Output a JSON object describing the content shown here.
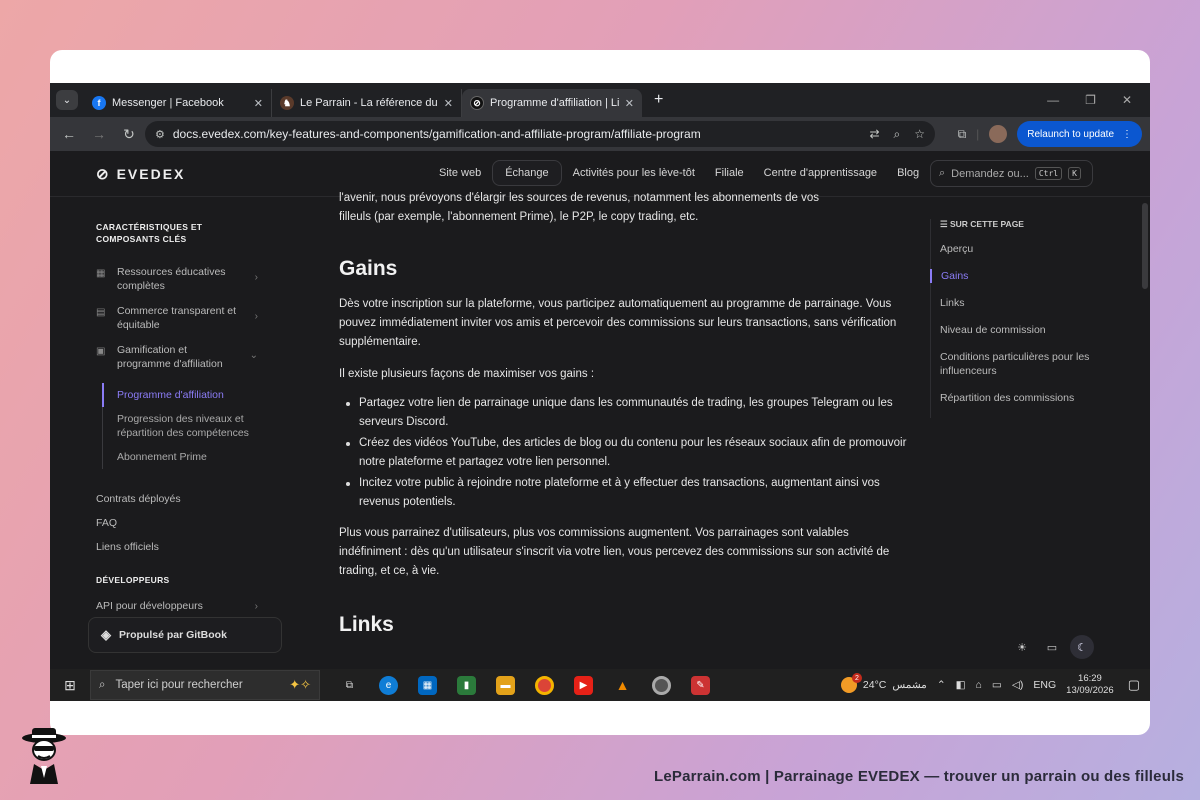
{
  "browser": {
    "tabs": [
      {
        "title": "Messenger | Facebook",
        "favicon": "facebook-icon"
      },
      {
        "title": "Le Parrain - La référence du parrainage",
        "favicon": "leparrain-icon"
      },
      {
        "title": "Programme d'affiliation | Livre blanc",
        "favicon": "evedex-icon"
      }
    ],
    "url": "docs.evedex.com/key-features-and-components/gamification-and-affiliate-program/affiliate-program",
    "relaunch_label": "Relaunch to update"
  },
  "site": {
    "logo": "EVEDEX",
    "nav": [
      "Site web",
      "Échange",
      "Activités pour les lève-tôt",
      "Filiale",
      "Centre d'apprentissage",
      "Blog"
    ],
    "search_placeholder": "Demandez ou...",
    "kbd_ctrl": "Ctrl",
    "kbd_k": "K"
  },
  "sidebar": {
    "section1": "CARACTÉRISTIQUES ET COMPOSANTS CLÉS",
    "items": [
      {
        "label": "Ressources éducatives complètes"
      },
      {
        "label": "Commerce transparent et équitable"
      },
      {
        "label": "Gamification et programme d'affiliation"
      }
    ],
    "subitems": [
      {
        "label": "Programme d'affiliation"
      },
      {
        "label": "Progression des niveaux et répartition des compétences"
      },
      {
        "label": "Abonnement Prime"
      }
    ],
    "links": [
      "Contrats déployés",
      "FAQ",
      "Liens officiels"
    ],
    "section2": "DÉVELOPPEURS",
    "dev_item": "API pour développeurs",
    "gitbook": "Propulsé par GitBook"
  },
  "content": {
    "top_fragment_1": "l'avenir, nous prévoyons d'élargir les sources de revenus, notamment les abonnements de vos",
    "top_fragment_2": "filleuls (par exemple, l'abonnement Prime), le P2P, le copy trading, etc.",
    "heading_gains": "Gains",
    "para1": "Dès votre inscription sur la plateforme, vous participez automatiquement au programme de parrainage. Vous pouvez immédiatement inviter vos amis et percevoir des commissions sur leurs transactions, sans vérification supplémentaire.",
    "para2": "Il existe plusieurs façons de maximiser vos gains :",
    "bullets": [
      "Partagez votre lien de parrainage unique dans les communautés de trading, les groupes Telegram ou les serveurs Discord.",
      "Créez des vidéos YouTube, des articles de blog ou du contenu pour les réseaux sociaux afin de promouvoir notre plateforme et partagez votre lien personnel.",
      "Incitez votre public à rejoindre notre plateforme et à y effectuer des transactions, augmentant ainsi vos revenus potentiels."
    ],
    "para3": "Plus vous parrainez d'utilisateurs, plus vos commissions augmentent. Vos parrainages sont valables indéfiniment : dès qu'un utilisateur s'inscrit via votre lien, vous percevez des commissions sur son activité de trading, et ce, à vie.",
    "heading_links": "Links"
  },
  "toc": {
    "heading": "SUR CETTE PAGE",
    "items": [
      "Aperçu",
      "Gains",
      "Links",
      "Niveau de commission",
      "Conditions particulières pour les influenceurs",
      "Répartition des commissions"
    ]
  },
  "taskbar": {
    "search_placeholder": "Taper ici pour rechercher",
    "weather_temp": "24°C",
    "weather_label": "مشمس",
    "weather_badge": "2",
    "lang": "ENG",
    "time": "16:29",
    "date": "13/09/2026"
  },
  "footer": {
    "text": "LeParrain.com | Parrainage EVEDEX — trouver un parrain ou des filleuls"
  },
  "colors": {
    "accent": "#8b7cf6",
    "page_bg": "#1b1b1d",
    "relaunch": "#0b57d0"
  }
}
